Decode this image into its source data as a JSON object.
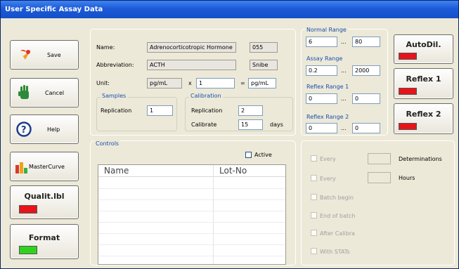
{
  "window": {
    "title": "User Specific Assay Data"
  },
  "buttons": {
    "save": "Save",
    "cancel": "Cancel",
    "help": "Help",
    "mastercurve": "MasterCurve",
    "qualit": "Qualit.lbl",
    "format": "Format",
    "autodil": "AutoDil.",
    "reflex1": "Reflex 1",
    "reflex2": "Reflex 2"
  },
  "colors": {
    "red_indicator": "#e8141c",
    "green_indicator": "#2fd31f",
    "title_blue": "#1c5ad8",
    "group_label": "#1c4db0"
  },
  "assay": {
    "name_label": "Name:",
    "name_value": "Adrenocorticotropic Hormone",
    "name_code": "055",
    "abbr_label": "Abbreviation:",
    "abbr_value": "ACTH",
    "abbr_maker": "Snibe",
    "unit_label": "Unit:",
    "unit_value": "pg/mL",
    "times": "x",
    "factor": "1",
    "equals": "=",
    "unit_result": "pg/mL"
  },
  "samples": {
    "group": "Samples",
    "replication_label": "Replication",
    "replication_value": "1"
  },
  "calibration": {
    "group": "Calibration",
    "replication_label": "Replication",
    "replication_value": "2",
    "calibrate_label": "Calibrate",
    "calibrate_value": "15",
    "days_label": "days"
  },
  "ranges": {
    "normal": {
      "label": "Normal Range",
      "low": "6",
      "sep": "...",
      "high": "80"
    },
    "assay": {
      "label": "Assay Range",
      "low": "0.2",
      "sep": "...",
      "high": "2000"
    },
    "reflex1": {
      "label": "Reflex Range 1",
      "low": "0",
      "sep": "...",
      "high": "0"
    },
    "reflex2": {
      "label": "Reflex Range 2",
      "low": "0",
      "sep": "...",
      "high": "0"
    }
  },
  "controls": {
    "group": "Controls",
    "active_label": "Active",
    "columns": [
      "Name",
      "Lot-No"
    ]
  },
  "qc": {
    "every1": "Every",
    "determinations": "Determinations",
    "every2": "Every",
    "hours": "Hours",
    "batch_begin": "Batch begin",
    "end_of_batch": "End of batch",
    "after_calibra": "After Calibra",
    "with_stats": "With STATs"
  }
}
